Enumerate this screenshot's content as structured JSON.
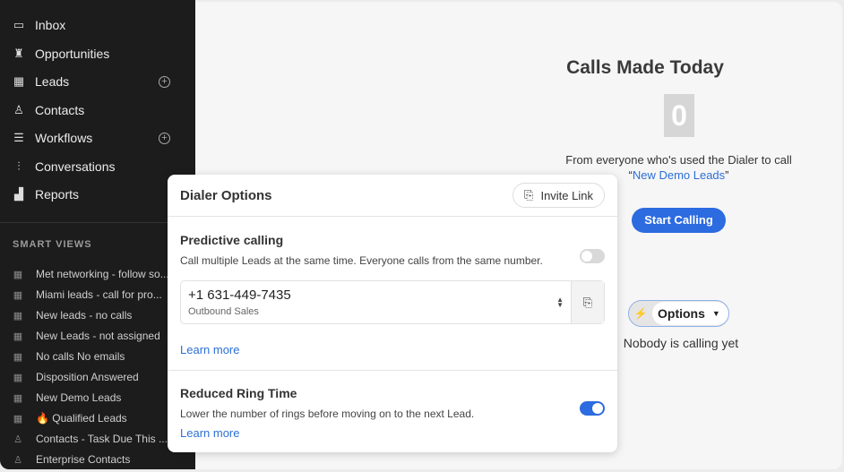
{
  "sidebar": {
    "nav": [
      {
        "label": "Inbox",
        "icon": "inbox-icon",
        "glyph": "▭"
      },
      {
        "label": "Opportunities",
        "icon": "trophy-icon",
        "glyph": "♜"
      },
      {
        "label": "Leads",
        "icon": "building-icon",
        "glyph": "▦",
        "add": true
      },
      {
        "label": "Contacts",
        "icon": "person-icon",
        "glyph": "♙"
      },
      {
        "label": "Workflows",
        "icon": "list-icon",
        "glyph": "☰",
        "add": true
      },
      {
        "label": "Conversations",
        "icon": "waveform-icon",
        "glyph": "⫶"
      },
      {
        "label": "Reports",
        "icon": "chart-icon",
        "glyph": "▟"
      }
    ],
    "smart_views_label": "SMART VIEWS",
    "smart_views": [
      {
        "label": "Met networking - follow so...",
        "icon": "building-icon"
      },
      {
        "label": "Miami leads - call for pro...",
        "icon": "building-icon"
      },
      {
        "label": "New leads - no calls",
        "icon": "building-icon"
      },
      {
        "label": "New Leads - not assigned",
        "icon": "building-icon"
      },
      {
        "label": "No calls No emails",
        "icon": "building-icon"
      },
      {
        "label": "Disposition Answered",
        "icon": "building-icon"
      },
      {
        "label": "New Demo Leads",
        "icon": "building-icon"
      },
      {
        "label": "🔥  Qualified Leads",
        "icon": "building-icon"
      },
      {
        "label": "Contacts - Task Due This ...",
        "icon": "person-icon"
      },
      {
        "label": "Enterprise Contacts",
        "icon": "person-icon"
      }
    ]
  },
  "main": {
    "title": "Calls Made Today",
    "count": "0",
    "subtitle": "From everyone who's used the Dialer to call",
    "view_link": "New Demo Leads",
    "start_label": "Start Calling",
    "options_label": "Options",
    "status": "Nobody is calling yet"
  },
  "dialer": {
    "title": "Dialer Options",
    "invite_label": "Invite Link",
    "predictive": {
      "title": "Predictive calling",
      "desc": "Call multiple Leads at the same time. Everyone calls from the same number.",
      "enabled": false,
      "learn_more": "Learn more"
    },
    "phone": {
      "number": "+1 631-449-7435",
      "label": "Outbound Sales"
    },
    "reduced": {
      "title": "Reduced Ring Time",
      "desc": "Lower the number of rings before moving on to the next Lead.",
      "enabled": true,
      "learn_more": "Learn more"
    }
  },
  "colors": {
    "accent": "#2c6be0",
    "sidebar": "#1c1c1c"
  }
}
